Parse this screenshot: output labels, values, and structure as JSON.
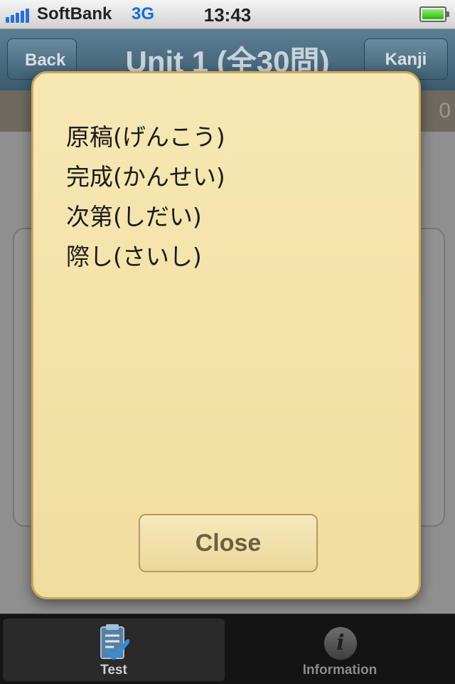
{
  "status_bar": {
    "carrier": "SoftBank",
    "network": "3G",
    "time": "13:43",
    "battery_level": 1.0
  },
  "nav_bar": {
    "title": "Unit 1 (全30問)",
    "back_label": "Back",
    "kanji_label": "Kanji"
  },
  "background": {
    "sub_text": "0"
  },
  "popup": {
    "items": [
      "原稿(げんこう)",
      "完成(かんせい)",
      "次第(しだい)",
      "際し(さいし)"
    ],
    "close_label": "Close"
  },
  "tab_bar": {
    "tabs": [
      {
        "label": "Test",
        "icon": "test-checklist-icon",
        "selected": true
      },
      {
        "label": "Information",
        "icon": "info-icon",
        "selected": false
      }
    ],
    "info_glyph": "i",
    "colors": {
      "selected": "#cfcfcf",
      "unselected": "#8a8a8a"
    }
  }
}
